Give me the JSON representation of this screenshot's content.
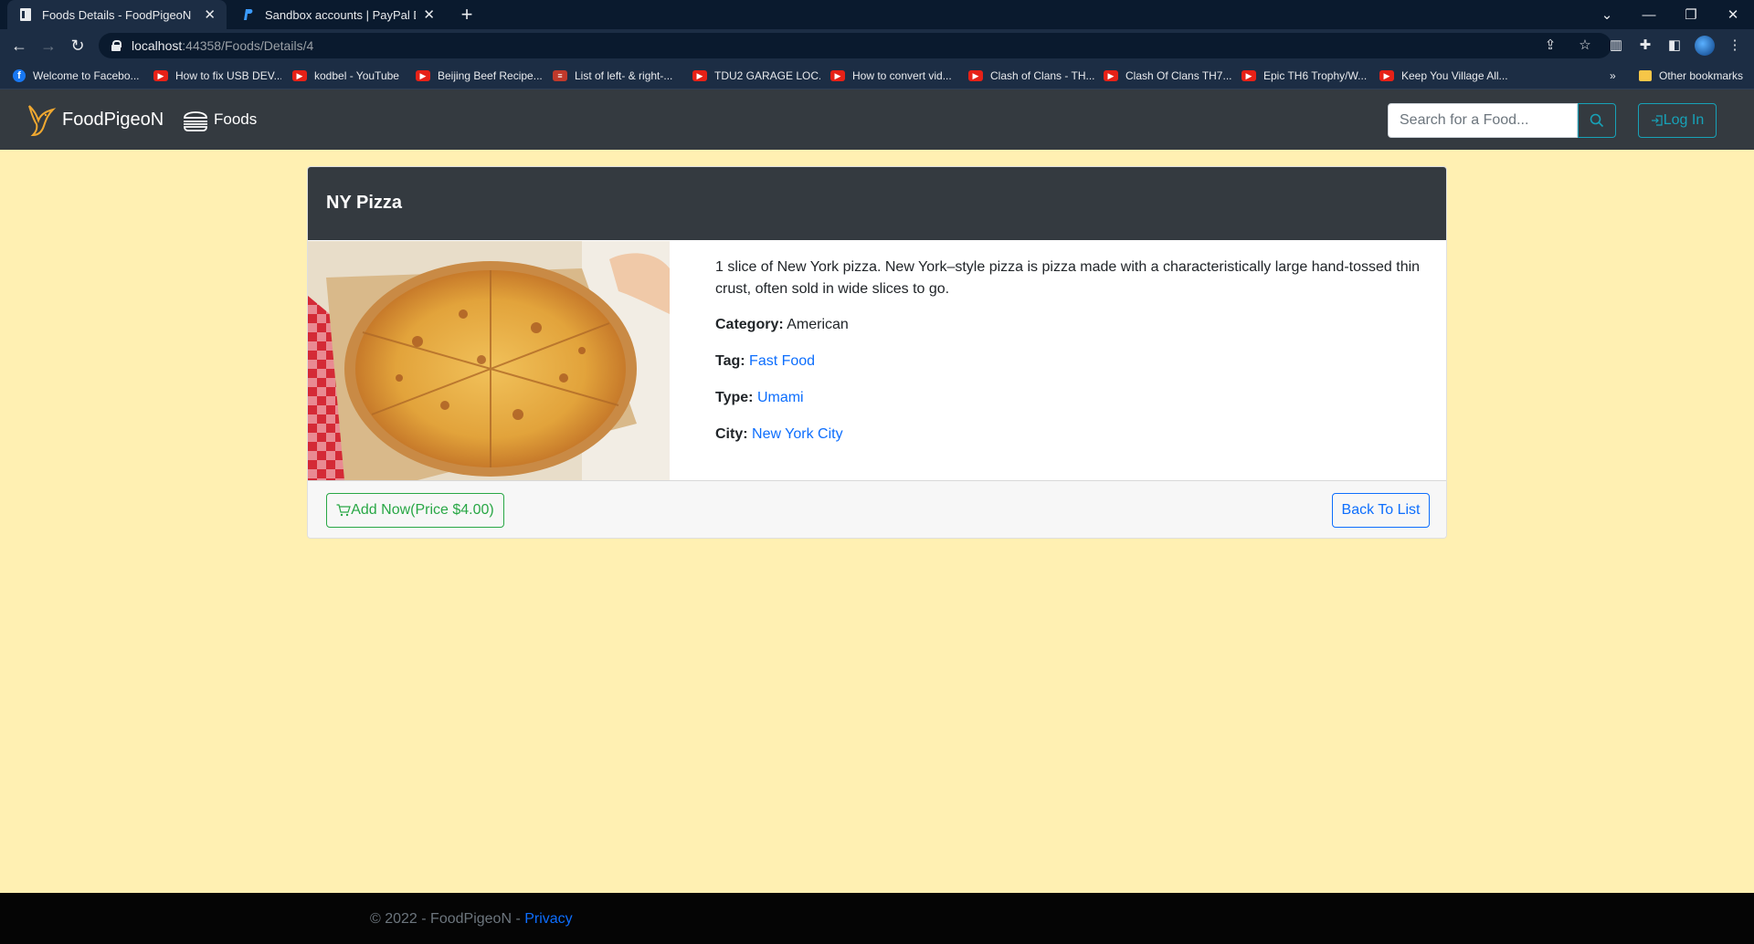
{
  "browser": {
    "tabs": [
      {
        "title": "Foods Details - FoodPigeoN",
        "active": true,
        "icon": "document-icon"
      },
      {
        "title": "Sandbox accounts | PayPal Devel",
        "active": false,
        "icon": "paypal-icon"
      }
    ],
    "url": {
      "host": "localhost",
      "path": ":44358/Foods/Details/4"
    },
    "bookmarks": [
      {
        "label": "Welcome to Facebo...",
        "icon": "facebook-icon"
      },
      {
        "label": "How to fix USB DEV...",
        "icon": "youtube-icon"
      },
      {
        "label": "kodbel - YouTube",
        "icon": "youtube-icon"
      },
      {
        "label": "Beijing Beef Recipe...",
        "icon": "youtube-icon"
      },
      {
        "label": "List of left- & right-...",
        "icon": "site-icon"
      },
      {
        "label": "TDU2 GARAGE LOC...",
        "icon": "youtube-icon"
      },
      {
        "label": "How to convert vid...",
        "icon": "youtube-icon"
      },
      {
        "label": "Clash of Clans - TH...",
        "icon": "youtube-icon"
      },
      {
        "label": "Clash Of Clans TH7...",
        "icon": "youtube-icon"
      },
      {
        "label": "Epic TH6 Trophy/W...",
        "icon": "youtube-icon"
      },
      {
        "label": "Keep You Village All...",
        "icon": "youtube-icon"
      }
    ],
    "bookmarks_overflow": "»",
    "other_bookmarks": "Other bookmarks"
  },
  "navbar": {
    "brand": "FoodPigeoN",
    "foods_link": "Foods",
    "search_placeholder": "Search for a Food...",
    "login_label": "Log In"
  },
  "food": {
    "name": "NY Pizza",
    "description": "1 slice of New York pizza. New York–style pizza is pizza made with a characteristically large hand-tossed thin crust, often sold in wide slices to go.",
    "category_label": "Category:",
    "category": "American",
    "tag_label": "Tag:",
    "tag": "Fast Food",
    "type_label": "Type:",
    "type": "Umami",
    "city_label": "City:",
    "city": "New York City",
    "add_button": "Add Now(Price $4.00)",
    "back_button": "Back To List"
  },
  "footer": {
    "copyright": "© 2022 - FoodPigeoN - ",
    "privacy": "Privacy"
  },
  "colors": {
    "page_bg": "#fff0b2",
    "navbar_bg": "#343a40",
    "info": "#17a2b8",
    "success": "#28a745",
    "primary": "#0d6efd"
  }
}
